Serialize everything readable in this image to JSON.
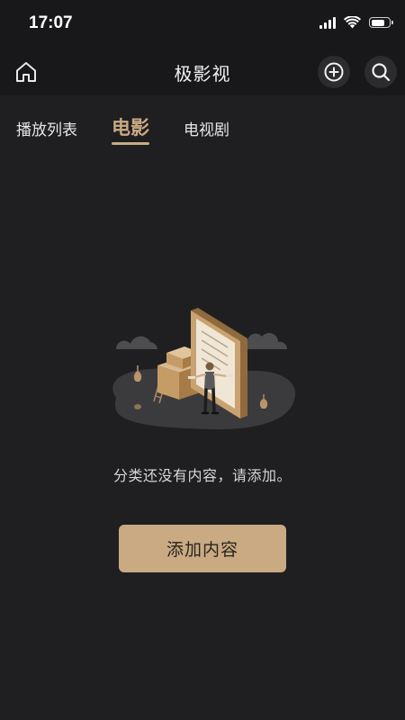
{
  "status_bar": {
    "time": "17:07"
  },
  "nav": {
    "title": "极影视",
    "home_icon": "home-icon",
    "add_icon": "plus-circle-icon",
    "search_icon": "search-icon"
  },
  "tabs": [
    {
      "label": "播放列表",
      "active": false
    },
    {
      "label": "电影",
      "active": true
    },
    {
      "label": "电视剧",
      "active": false
    }
  ],
  "empty_state": {
    "message": "分类还没有内容，请添加。",
    "illustration": "empty-boxes-illustration"
  },
  "actions": {
    "add_label": "添加内容"
  },
  "colors": {
    "accent": "#c9aa83",
    "background": "#1f1f21",
    "bar_background": "#18181a",
    "button_text": "#2a241c"
  }
}
